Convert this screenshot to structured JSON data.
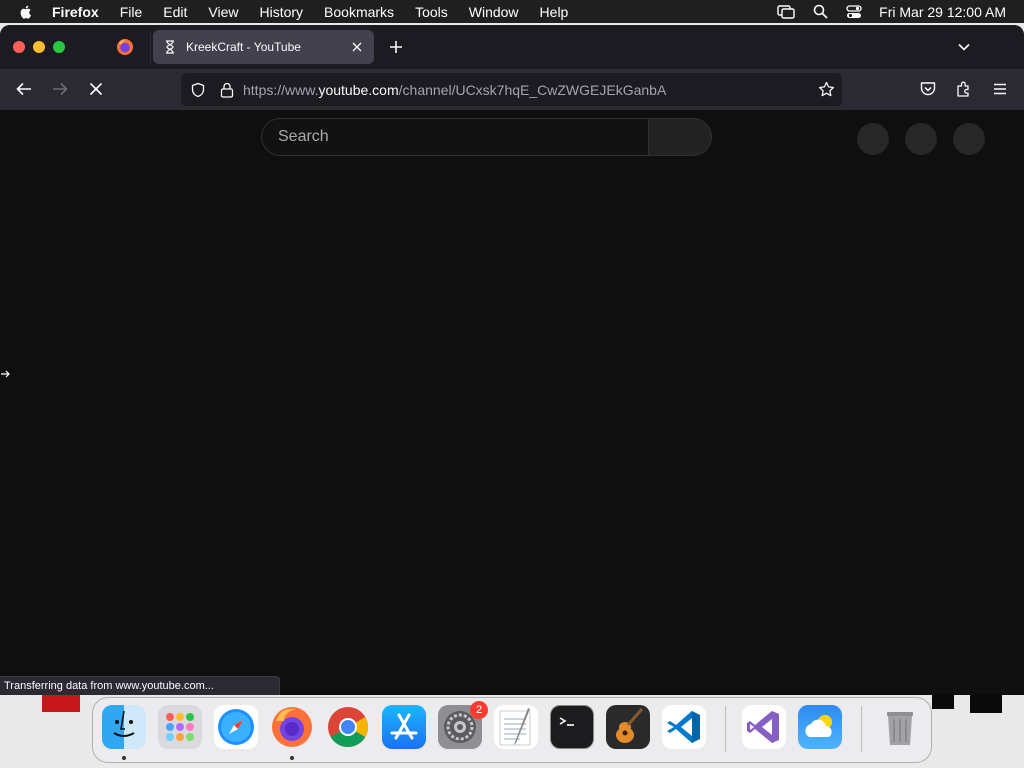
{
  "menubar": {
    "app_name": "Firefox",
    "items": [
      "File",
      "Edit",
      "View",
      "History",
      "Bookmarks",
      "Tools",
      "Window",
      "Help"
    ],
    "clock": "Fri Mar 29  12:00 AM"
  },
  "browser": {
    "active_tab": {
      "title": "KreekCraft - YouTube",
      "icon": "hourglass-loading-icon"
    },
    "url": {
      "prefix": "https://www.",
      "domain": "youtube.com",
      "path": "/channel/UCxsk7hqE_CwZWGEJEkGanbA"
    },
    "status_text": "Transferring data from www.youtube.com..."
  },
  "youtube": {
    "search_placeholder": "Search"
  },
  "dock": {
    "apps": [
      {
        "name": "Finder",
        "icon": "finder-icon",
        "running": true
      },
      {
        "name": "Launchpad",
        "icon": "launchpad-icon",
        "running": false
      },
      {
        "name": "Safari",
        "icon": "safari-icon",
        "running": false
      },
      {
        "name": "Firefox",
        "icon": "firefox-icon",
        "running": true
      },
      {
        "name": "Chrome",
        "icon": "chrome-icon",
        "running": false
      },
      {
        "name": "App Store",
        "icon": "app-store-icon",
        "running": false
      },
      {
        "name": "System Settings",
        "icon": "system-settings-icon",
        "running": false,
        "badge": "2"
      },
      {
        "name": "TextEdit",
        "icon": "textedit-icon",
        "running": false
      },
      {
        "name": "Terminal",
        "icon": "terminal-icon",
        "running": false
      },
      {
        "name": "GarageBand",
        "icon": "garageband-icon",
        "running": false
      },
      {
        "name": "VS Code",
        "icon": "vscode-icon",
        "running": false
      },
      {
        "name": "Visual Studio",
        "icon": "visual-studio-icon",
        "running": false
      },
      {
        "name": "Weather",
        "icon": "weather-icon",
        "running": false
      },
      {
        "name": "Trash",
        "icon": "trash-icon",
        "running": false
      }
    ]
  },
  "colors": {
    "page_bg": "#0f0f0f",
    "tabbar_bg": "#1c1b22",
    "navbar_bg": "#2b2a33",
    "active_tab_bg": "#42414d"
  }
}
